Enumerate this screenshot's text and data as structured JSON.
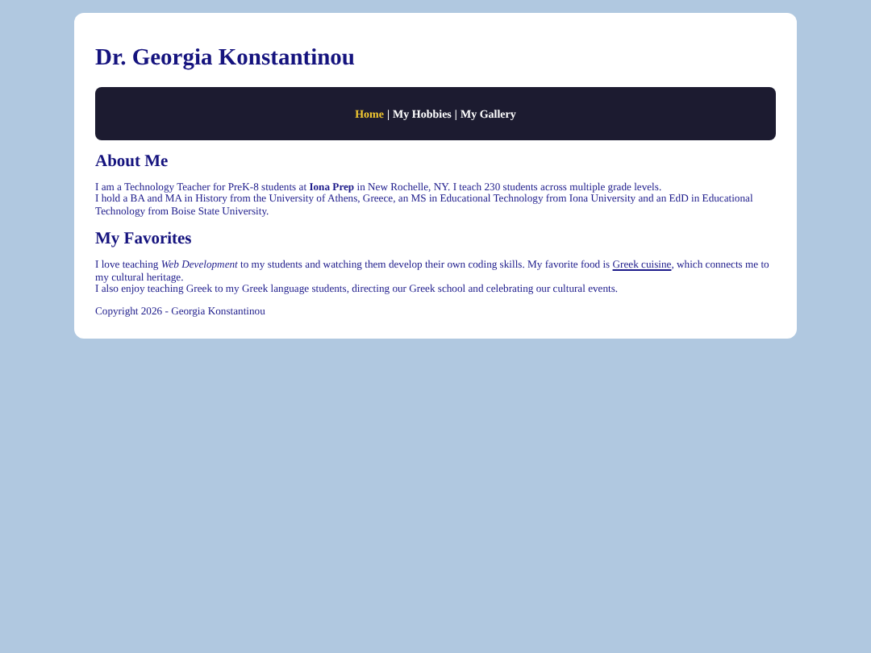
{
  "title": "Dr. Georgia Konstantinou",
  "nav": {
    "separator": "|",
    "items": [
      {
        "label": "Home",
        "selected": true
      },
      {
        "label": "My Hobbies",
        "selected": false
      },
      {
        "label": "My Gallery",
        "selected": false
      }
    ]
  },
  "about": {
    "heading": "About Me",
    "lines": [
      "I am a Technology Teacher for PreK-8 students at **Iona Prep** in New Rochelle, NY. I teach 230 students across multiple grade levels.",
      "I hold a BA and MA in History from the University of Athens, Greece, an MS in Educational Technology from Iona University and an EdD in Educational Technology from Boise State University."
    ]
  },
  "favorites": {
    "heading": "My Favorites",
    "line1": {
      "before": "I love teaching *Web Development* to my students and watching them develop their own coding skills. My favorite food is ",
      "link": "Greek cuisine",
      "after": ", which connects me to my cultural heritage."
    },
    "line2": "I also enjoy teaching Greek to my Greek language students, directing our Greek school and celebrating our cultural events."
  },
  "footer": "Copyright 2026 - Georgia Konstantinou"
}
